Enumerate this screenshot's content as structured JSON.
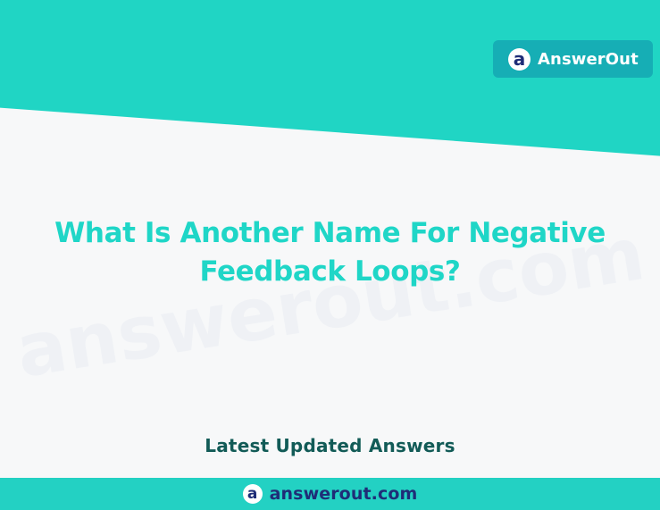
{
  "brand": {
    "logo_letter": "a",
    "name": "AnswerOut"
  },
  "watermark": {
    "text": "answerout.com"
  },
  "main": {
    "headline": "What Is Another Name For Negative Feedback Loops?",
    "section_label": "Latest Updated Answers"
  },
  "footer": {
    "logo_letter": "a",
    "domain": "answerout.com"
  },
  "colors": {
    "teal": "#20d5c4",
    "dark_teal": "#16aeb5",
    "headline": "#1fd6c7",
    "label": "#125b57",
    "navy": "#1f2d77",
    "background": "#f7f8f9"
  }
}
